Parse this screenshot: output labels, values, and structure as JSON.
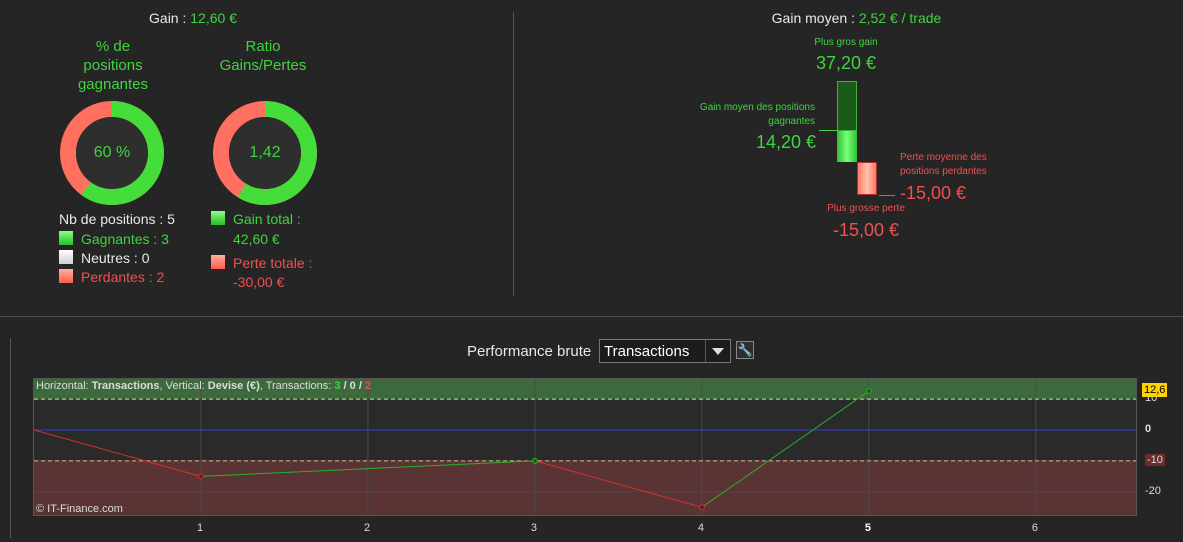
{
  "summary": {
    "gain_label": "Gain : ",
    "gain_value": "12,60 €",
    "pct_title": "% de\npositions\ngagnantes",
    "pct_value": "60 %",
    "pct_fraction": 0.6,
    "ratio_title": "Ratio\nGains/Pertes",
    "ratio_value": "1,42",
    "ratio_fraction": 0.5867,
    "nb_positions": "Nb de positions : 5",
    "gagnantes": "Gagnantes : 3",
    "neutres": "Neutres : 0",
    "perdantes": "Perdantes : 2",
    "gain_total_label": "Gain total :",
    "gain_total_value": "42,60 €",
    "perte_totale_label": "Perte totale :",
    "perte_totale_value": "-30,00 €"
  },
  "average": {
    "title_label": "Gain moyen : ",
    "title_value": "2,52 € / trade",
    "plus_gros_gain_label": "Plus gros gain",
    "plus_gros_gain_value": "37,20 €",
    "gain_moyen_label": "Gain moyen des positions gagnantes",
    "gain_moyen_value": "14,20 €",
    "perte_moyenne_label": "Perte moyenne des positions perdantes",
    "perte_moyenne_value": "-15,00 €",
    "plus_grosse_perte_label": "Plus grosse perte",
    "plus_grosse_perte_value": "-15,00 €"
  },
  "perf": {
    "title": "Performance brute",
    "select_value": "Transactions",
    "info_h_label": "Horizontal: ",
    "info_h_value": "Transactions",
    "info_v_label": ", Vertical: ",
    "info_v_value": "Devise (€)",
    "info_t_label": ", Transactions: ",
    "info_t_win": "3",
    "info_t_sep1": " / ",
    "info_t_neutral": "0",
    "info_t_sep2": " / ",
    "info_t_loss": "2",
    "copyright": "© IT-Finance.com",
    "current_value_badge": "12,6"
  },
  "colors": {
    "green": "#3fd43f",
    "red": "#f05050",
    "badge": "#ffd200"
  },
  "chart_data": {
    "type": "line",
    "x_ticks": [
      "1",
      "2",
      "3",
      "4",
      "5",
      "6"
    ],
    "y_ticks": [
      "10",
      "0",
      "-10",
      "-20"
    ],
    "ylim": [
      -27.5,
      16.5
    ],
    "xlim": [
      0,
      6.6
    ],
    "series": [
      {
        "x": [
          0,
          1,
          3,
          4,
          5
        ],
        "y": [
          0,
          -15,
          -10,
          -25,
          12.6
        ]
      }
    ],
    "highlight_x": "5",
    "max_gain_level": 10,
    "max_loss_level": -10
  }
}
